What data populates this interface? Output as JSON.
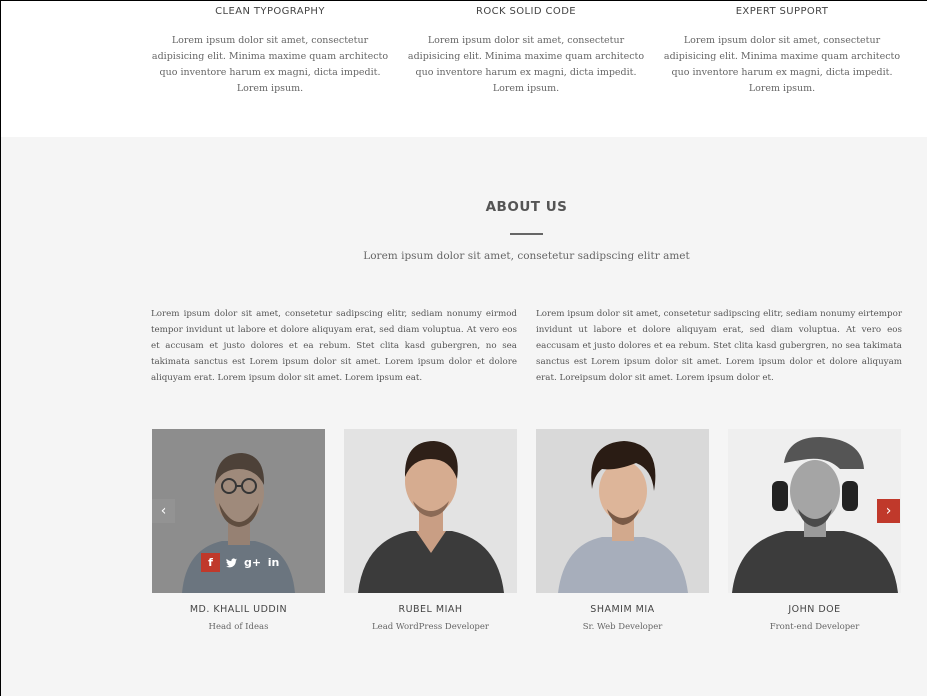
{
  "features": [
    {
      "title": "CLEAN TYPOGRAPHY",
      "text": "Lorem ipsum dolor sit amet, consectetur adipisicing elit. Minima maxime quam architecto quo inventore harum ex magni, dicta impedit. Lorem ipsum."
    },
    {
      "title": "ROCK SOLID CODE",
      "text": "Lorem ipsum dolor sit amet, consectetur adipisicing elit. Minima maxime quam architecto quo inventore harum ex magni, dicta impedit. Lorem ipsum."
    },
    {
      "title": "EXPERT SUPPORT",
      "text": "Lorem ipsum dolor sit amet, consectetur adipisicing elit. Minima maxime quam architecto quo inventore harum ex magni, dicta impedit. Lorem ipsum."
    }
  ],
  "about": {
    "title": "ABOUT US",
    "subtitle": "Lorem ipsum dolor sit amet, consetetur sadipscing elitr amet",
    "col_left": "Lorem ipsum dolor sit amet, consetetur sadipscing elitr, sediam nonumy eirmod tempor invidunt ut labore et dolore aliquyam erat, sed diam voluptua. At vero eos et accusam et justo dolores et ea rebum. Stet clita kasd gubergren, no sea takimata sanctus est Lorem ipsum dolor sit amet. Lorem ipsum dolor et dolore aliquyam erat. Lorem ipsum dolor sit amet. Lorem ipsum eat.",
    "col_right": "Lorem ipsum dolor sit amet, consetetur sadipscing elitr, sediam nonumy eirtempor invidunt ut labore et dolore aliquyam erat, sed diam voluptua. At vero eos eaccusam et justo dolores et ea rebum. Stet clita kasd gubergren, no sea takimata sanctus est Lorem ipsum dolor sit amet. Lorem ipsum dolor et dolore aliquyam erat. Loreipsum dolor sit amet. Lorem ipsum dolor et."
  },
  "team": [
    {
      "name": "MD. KHALIL UDDIN",
      "role": "Head of Ideas"
    },
    {
      "name": "RUBEL MIAH",
      "role": "Lead WordPress Developer"
    },
    {
      "name": "SHAMIM MIA",
      "role": "Sr. Web Developer"
    },
    {
      "name": "JOHN DOE",
      "role": "Front-end Developer"
    }
  ],
  "social": {
    "facebook": "f",
    "twitter": "twitter-icon",
    "google": "g+",
    "linkedin": "in"
  },
  "carousel": {
    "prev": "‹",
    "next": "›"
  },
  "colors": {
    "accent": "#c0392b",
    "background": "#f5f5f5"
  }
}
